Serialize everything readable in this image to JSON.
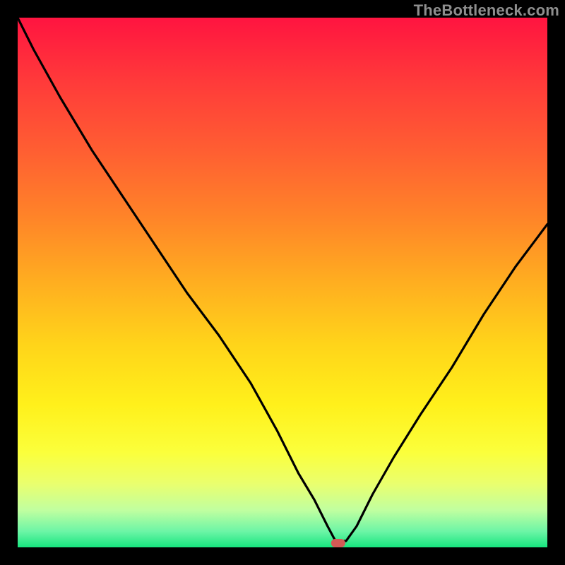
{
  "watermark": "TheBottleneck.com",
  "chart_data": {
    "type": "line",
    "title": "",
    "xlabel": "",
    "ylabel": "",
    "xlim": [
      0,
      100
    ],
    "ylim": [
      0,
      100
    ],
    "grid": false,
    "legend": false,
    "series": [
      {
        "name": "bottleneck-curve",
        "x": [
          0,
          3,
          8,
          14,
          20,
          26,
          32,
          38,
          44,
          49,
          53,
          56,
          58.5,
          60,
          62,
          64,
          67,
          71,
          76,
          82,
          88,
          94,
          100
        ],
        "y": [
          100,
          94,
          85,
          75,
          66,
          57,
          48,
          40,
          31,
          22,
          14,
          9,
          4,
          1.2,
          1.2,
          4,
          10,
          17,
          25,
          34,
          44,
          53,
          61
        ]
      }
    ],
    "marker": {
      "name": "optimum-marker",
      "x": 60.5,
      "y": 0.8,
      "color": "#d35a56"
    },
    "background_gradient": {
      "top_color": "#ff1440",
      "mid_colors": [
        "#ff4e35",
        "#ff8a2b",
        "#ffc723",
        "#fff31f",
        "#f9ff52",
        "#b6ff8e"
      ],
      "bottom_color": "#17e57f"
    }
  }
}
